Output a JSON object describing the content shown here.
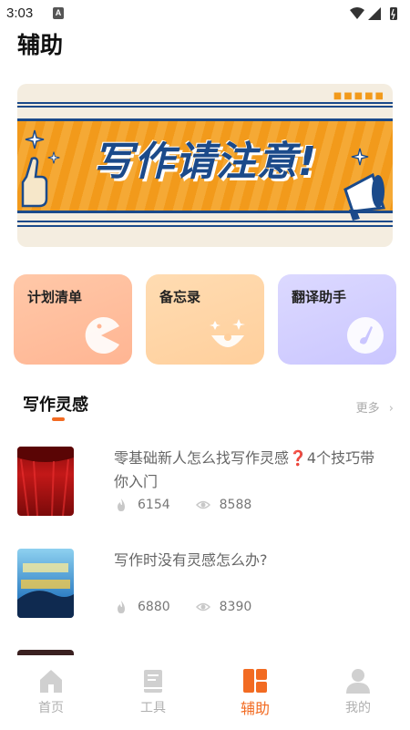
{
  "status_bar": {
    "time": "3:03",
    "notification_letter": "A"
  },
  "page": {
    "title": "辅助"
  },
  "banner": {
    "text": "写作请注意!"
  },
  "tools": [
    {
      "label": "计划清单",
      "icon": "pacman-icon"
    },
    {
      "label": "备忘录",
      "icon": "clown-icon"
    },
    {
      "label": "翻译助手",
      "icon": "note-icon"
    }
  ],
  "section": {
    "title": "写作灵感",
    "more_label": "更多"
  },
  "articles": [
    {
      "title": "零基础新人怎么找写作灵感❓4个技巧带你入门",
      "likes": "6154",
      "views": "8588"
    },
    {
      "title": "写作时没有灵感怎么办?",
      "likes": "6880",
      "views": "8390"
    }
  ],
  "tabbar": {
    "items": [
      {
        "label": "首页",
        "icon": "home-icon"
      },
      {
        "label": "工具",
        "icon": "book-icon"
      },
      {
        "label": "辅助",
        "icon": "grid-icon"
      },
      {
        "label": "我的",
        "icon": "user-icon"
      }
    ],
    "active_index": 2
  },
  "colors": {
    "accent": "#f26b22",
    "banner_orange": "#f29a1b",
    "banner_blue": "#1b4a8a"
  }
}
